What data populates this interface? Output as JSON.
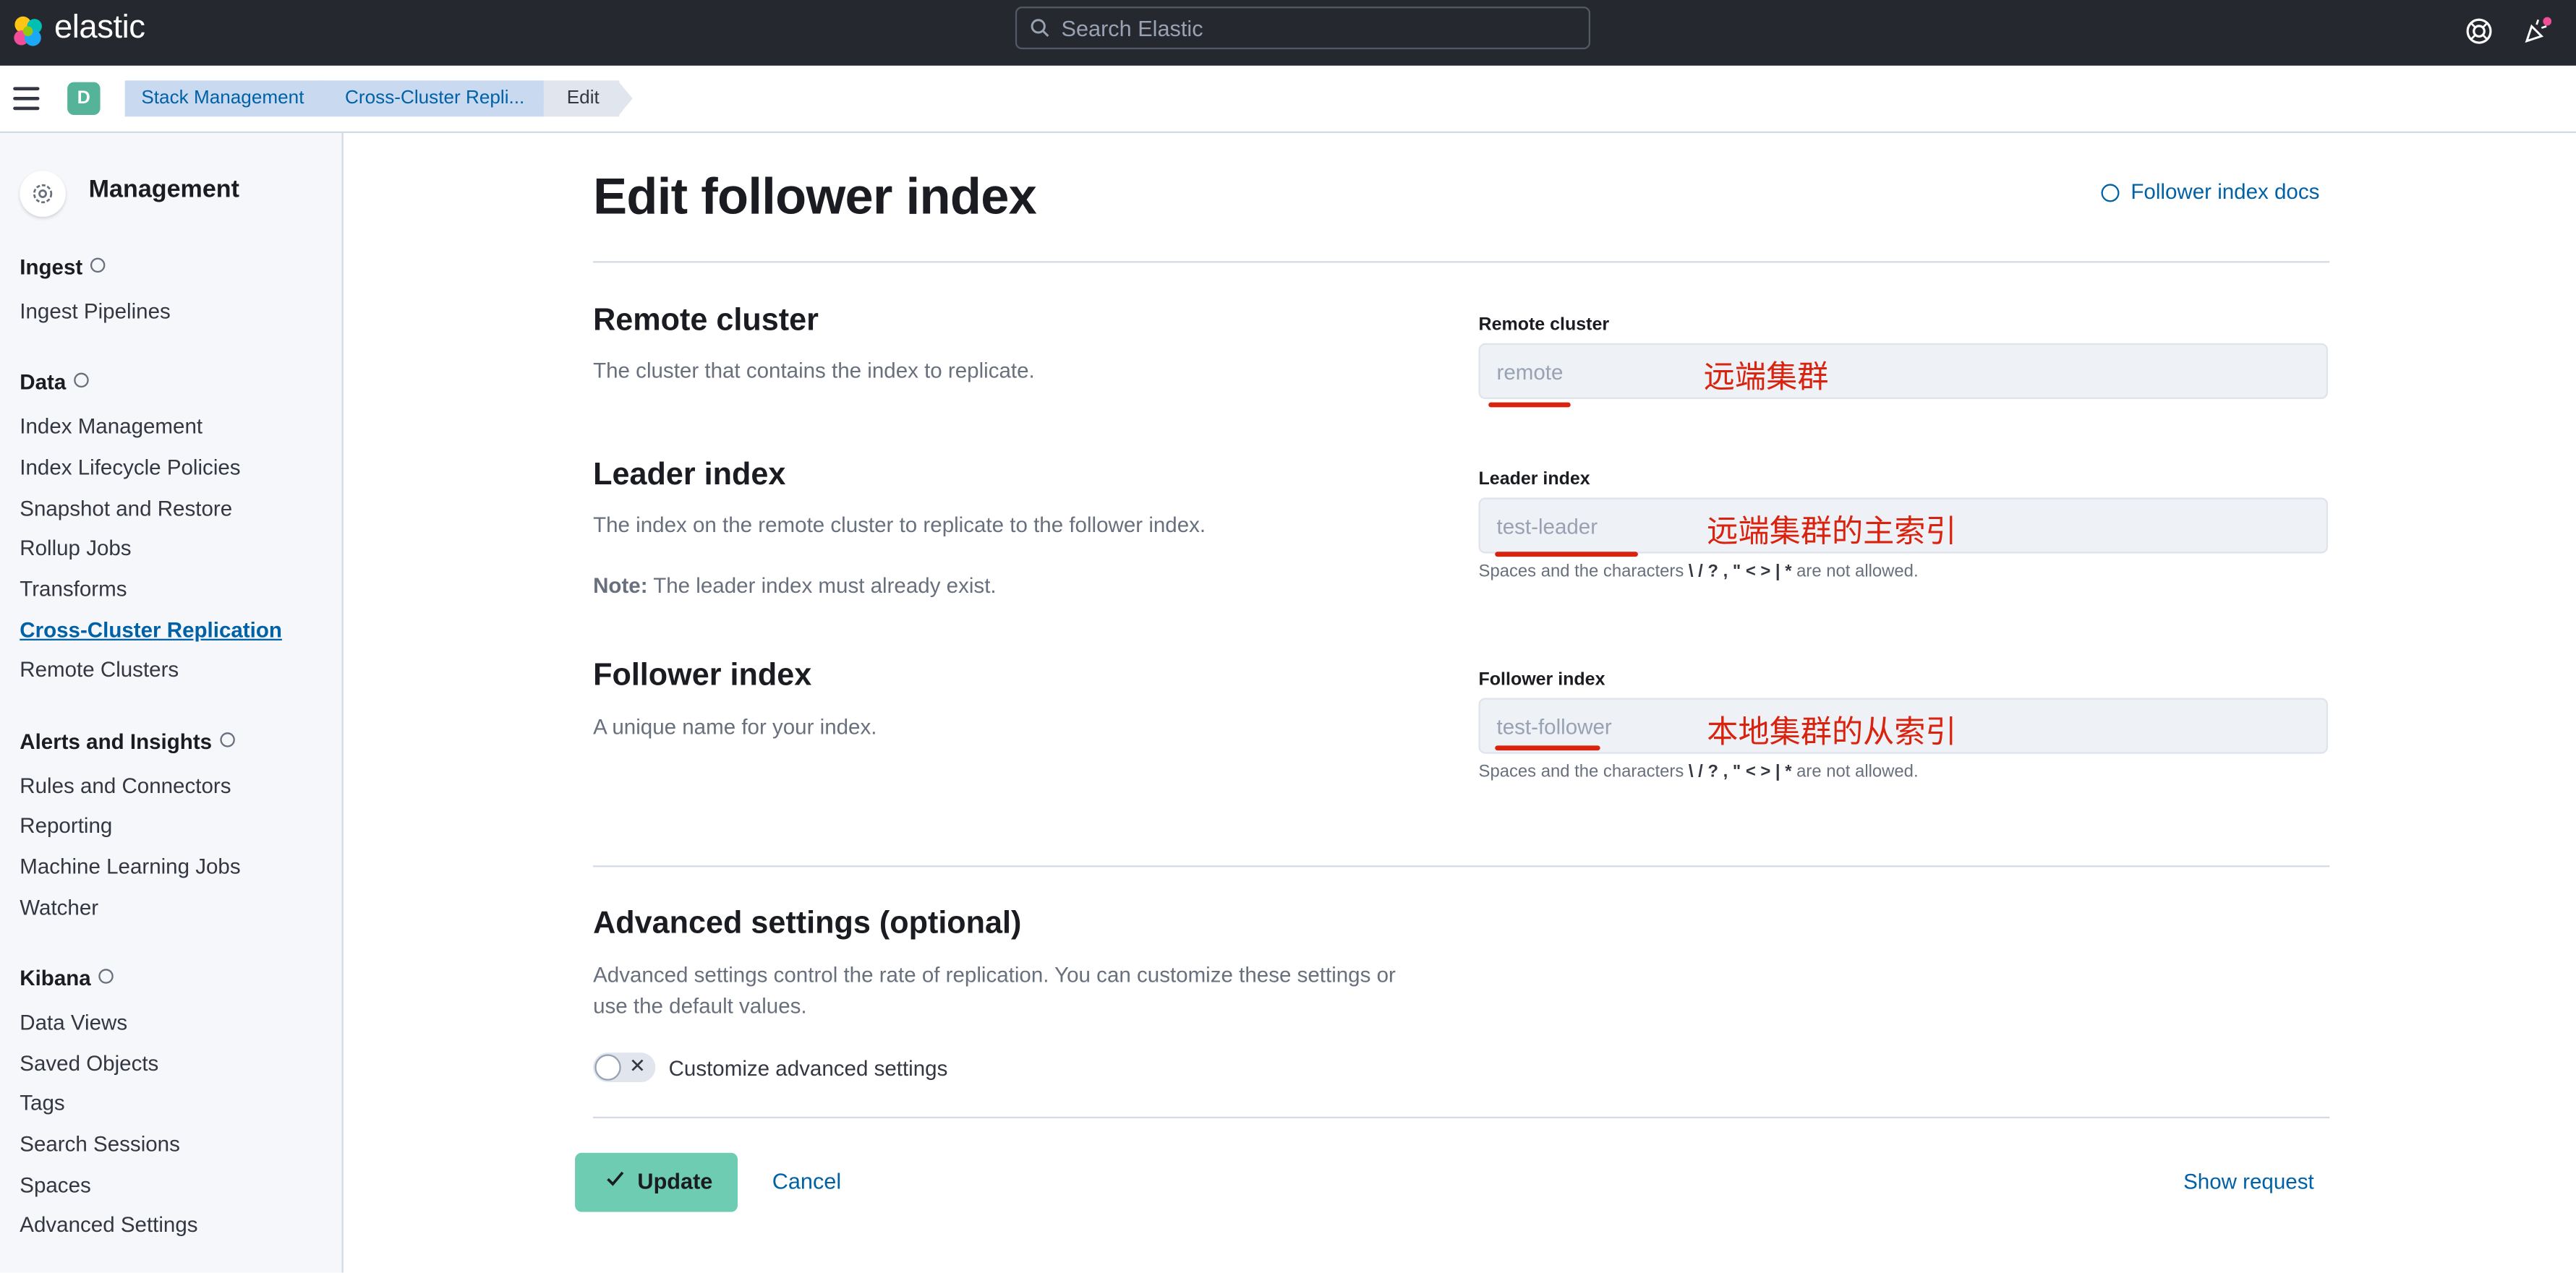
{
  "header": {
    "brand": "elastic",
    "search_placeholder": "Search Elastic"
  },
  "breadcrumbs": {
    "space_initial": "D",
    "items": [
      "Stack Management",
      "Cross-Cluster Repli...",
      "Edit"
    ]
  },
  "sidebar": {
    "title": "Management",
    "groups": [
      {
        "label": "Ingest",
        "items": [
          "Ingest Pipelines"
        ]
      },
      {
        "label": "Data",
        "items": [
          "Index Management",
          "Index Lifecycle Policies",
          "Snapshot and Restore",
          "Rollup Jobs",
          "Transforms",
          "Cross-Cluster Replication",
          "Remote Clusters"
        ]
      },
      {
        "label": "Alerts and Insights",
        "items": [
          "Rules and Connectors",
          "Reporting",
          "Machine Learning Jobs",
          "Watcher"
        ]
      },
      {
        "label": "Kibana",
        "items": [
          "Data Views",
          "Saved Objects",
          "Tags",
          "Search Sessions",
          "Spaces",
          "Advanced Settings"
        ]
      }
    ],
    "active_item": "Cross-Cluster Replication"
  },
  "page": {
    "title": "Edit follower index",
    "docs_link": "Follower index docs"
  },
  "sections": {
    "remote": {
      "title": "Remote cluster",
      "description": "The cluster that contains the index to replicate.",
      "field_label": "Remote cluster",
      "field_value": "remote",
      "annotation": "远端集群"
    },
    "leader": {
      "title": "Leader index",
      "description": "The index on the remote cluster to replicate to the follower index.",
      "note_label": "Note:",
      "note_text": " The leader index must already exist.",
      "field_label": "Leader index",
      "field_value": "test-leader",
      "annotation": "远端集群的主索引",
      "help_prefix": "Spaces and the characters ",
      "help_chars": "\\ / ? , \" < > | *",
      "help_suffix": " are not allowed."
    },
    "follower": {
      "title": "Follower index",
      "description": "A unique name for your index.",
      "field_label": "Follower index",
      "field_value": "test-follower",
      "annotation": "本地集群的从索引",
      "help_prefix": "Spaces and the characters ",
      "help_chars": "\\ / ? , \" < > | *",
      "help_suffix": " are not allowed."
    },
    "advanced": {
      "title": "Advanced settings (optional)",
      "description_line1": "Advanced settings control the rate of replication. You can customize these settings or",
      "description_line2": "use the default values.",
      "toggle_label": "Customize advanced settings",
      "toggle_on": false
    }
  },
  "actions": {
    "update": "Update",
    "cancel": "Cancel",
    "show_request": "Show request"
  },
  "colors": {
    "accent_link": "#0061a6",
    "primary_button": "#6dccb1",
    "annotation": "#d9230f",
    "header_bg": "#25282f"
  }
}
